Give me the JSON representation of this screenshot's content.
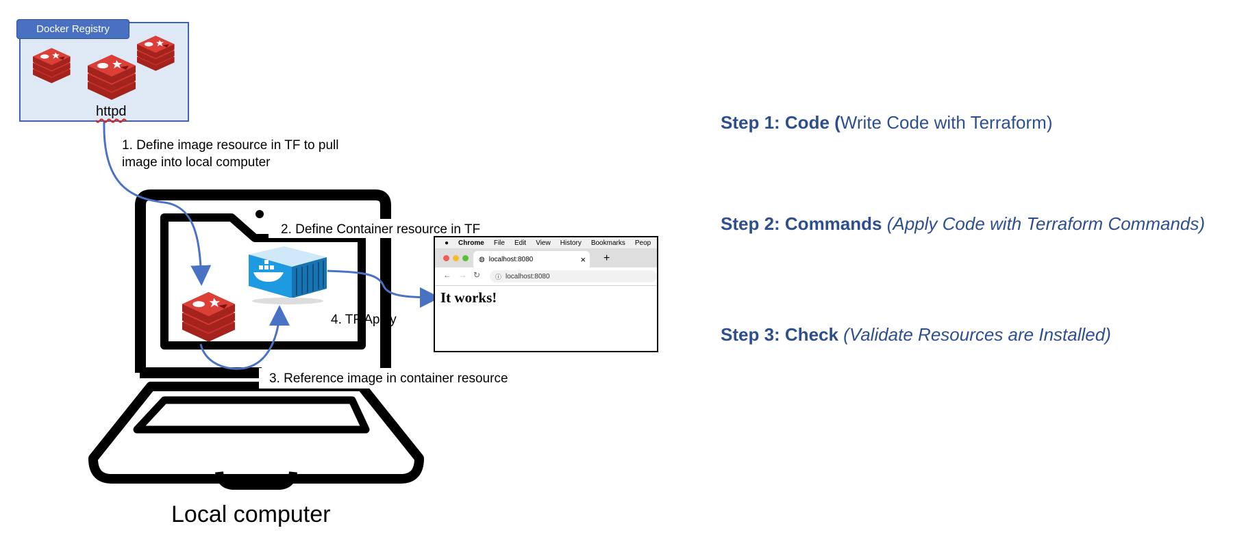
{
  "registry": {
    "title": "Docker Registry",
    "image_label": "httpd"
  },
  "annotations": {
    "step1_line1": "1. Define image resource in TF to pull",
    "step1_line2": "image into local computer",
    "step2": "2. Define Container resource in TF",
    "step3": "3. Reference image in container resource",
    "step4": "4. TF Apply"
  },
  "computer_label": "Local computer",
  "browser": {
    "menu": [
      "Chrome",
      "File",
      "Edit",
      "View",
      "History",
      "Bookmarks",
      "Peop"
    ],
    "tab_title": "localhost:8080",
    "tab_close": "×",
    "new_tab": "+",
    "url": "localhost:8080",
    "page_text": "It works!"
  },
  "steps": [
    {
      "bold": "Step 1: Code (",
      "rest": "Write Code with Terraform)"
    },
    {
      "bold": "Step 2: Commands",
      "rest": " (Apply Code with Terraform Commands)"
    },
    {
      "bold": "Step 3: Check",
      "rest": " (Validate Resources are Installed)"
    }
  ],
  "colors": {
    "step_text": "#2e4f8f",
    "arrow": "#4a72c4",
    "redis_red": "#c8312b",
    "registry_fill": "#dfe8f5"
  },
  "icons": [
    "redis-icon",
    "docker-container-icon",
    "laptop-icon",
    "apple-icon"
  ]
}
